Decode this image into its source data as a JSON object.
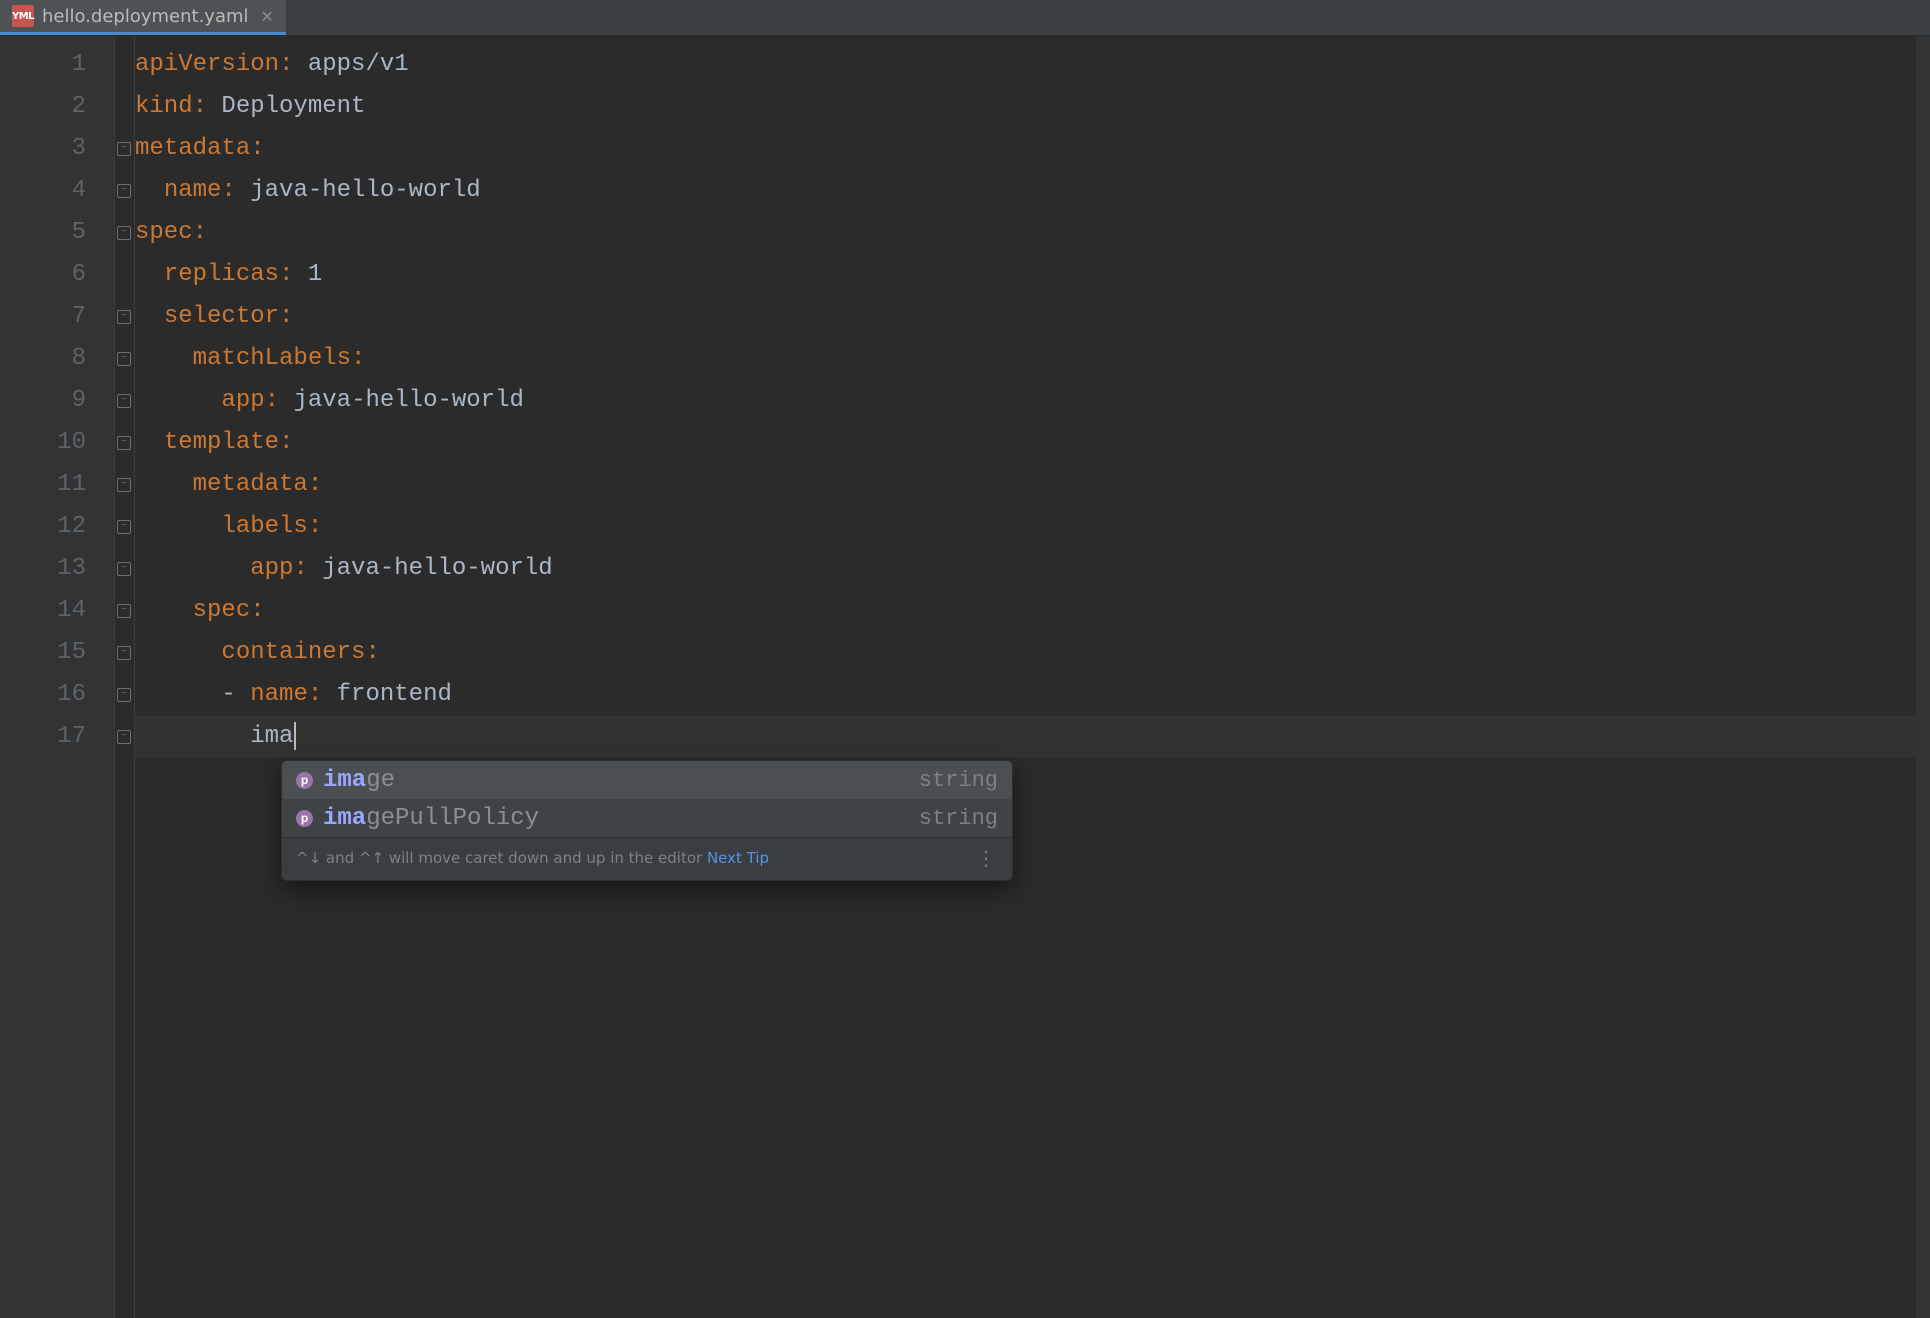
{
  "tab": {
    "filename": "hello.deployment.yaml",
    "icon_label": "YML"
  },
  "lines": [
    {
      "num": "1",
      "indent": 0,
      "key": "apiVersion",
      "sep": ": ",
      "val": "apps/v1"
    },
    {
      "num": "2",
      "indent": 0,
      "key": "kind",
      "sep": ": ",
      "val": "Deployment"
    },
    {
      "num": "3",
      "indent": 0,
      "key": "metadata",
      "sep": ":",
      "val": ""
    },
    {
      "num": "4",
      "indent": 1,
      "key": "name",
      "sep": ": ",
      "val": "java-hello-world"
    },
    {
      "num": "5",
      "indent": 0,
      "key": "spec",
      "sep": ":",
      "val": ""
    },
    {
      "num": "6",
      "indent": 1,
      "key": "replicas",
      "sep": ": ",
      "val": "1"
    },
    {
      "num": "7",
      "indent": 1,
      "key": "selector",
      "sep": ":",
      "val": ""
    },
    {
      "num": "8",
      "indent": 2,
      "key": "matchLabels",
      "sep": ":",
      "val": ""
    },
    {
      "num": "9",
      "indent": 3,
      "key": "app",
      "sep": ": ",
      "val": "java-hello-world"
    },
    {
      "num": "10",
      "indent": 1,
      "key": "template",
      "sep": ":",
      "val": ""
    },
    {
      "num": "11",
      "indent": 2,
      "key": "metadata",
      "sep": ":",
      "val": ""
    },
    {
      "num": "12",
      "indent": 3,
      "key": "labels",
      "sep": ":",
      "val": ""
    },
    {
      "num": "13",
      "indent": 4,
      "key": "app",
      "sep": ": ",
      "val": "java-hello-world"
    },
    {
      "num": "14",
      "indent": 2,
      "key": "spec",
      "sep": ":",
      "val": ""
    },
    {
      "num": "15",
      "indent": 3,
      "key": "containers",
      "sep": ":",
      "val": ""
    },
    {
      "num": "16",
      "indent": 3,
      "dash": "- ",
      "key": "name",
      "sep": ": ",
      "val": "frontend"
    },
    {
      "num": "17",
      "indent": 4,
      "typed": "ima",
      "current": true
    }
  ],
  "completion": {
    "items": [
      {
        "icon": "p",
        "match": "ima",
        "rest": "ge",
        "type": "string",
        "selected": true
      },
      {
        "icon": "p",
        "match": "ima",
        "rest": "gePullPolicy",
        "type": "string",
        "selected": false
      }
    ],
    "hint_shortcut": "^↓ and ^↑",
    "hint_text": " will move caret down and up in the editor  ",
    "hint_link": "Next Tip",
    "hint_menu": "⋮"
  }
}
